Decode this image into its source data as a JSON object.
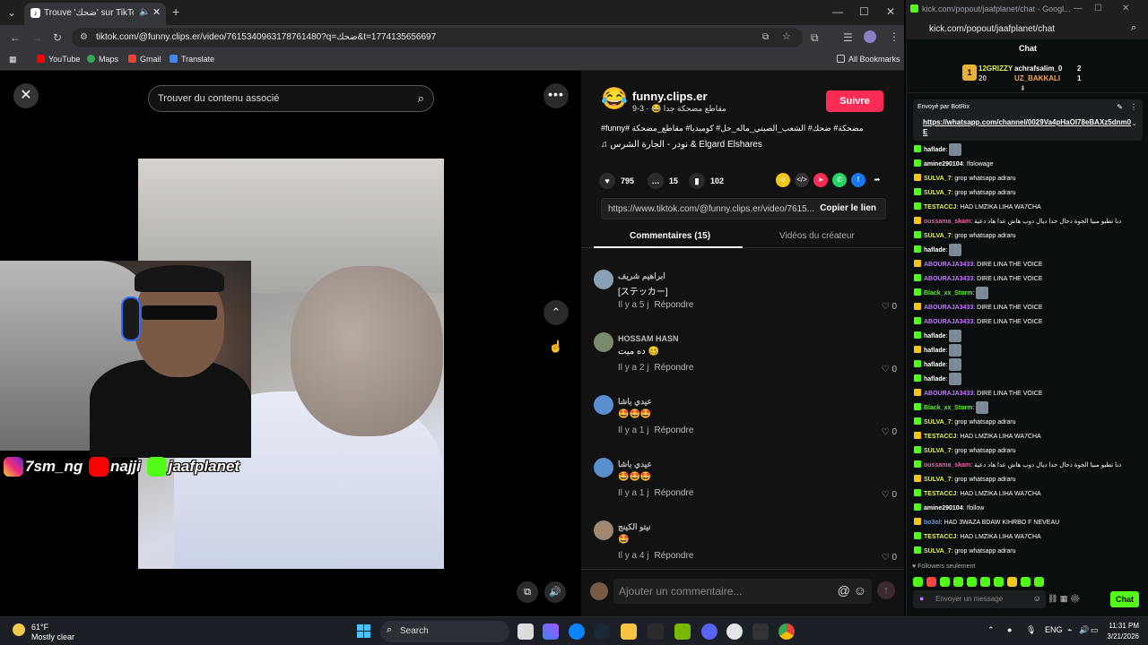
{
  "browser": {
    "tab_title": "Trouve 'ضحك' sur TikTok | T",
    "url": "tiktok.com/@funny.clips.er/video/7615340963178761480?q=ضحك&t=1774135656697",
    "bookmarks": [
      "YouTube",
      "Maps",
      "Gmail",
      "Translate"
    ],
    "all_bookmarks": "All Bookmarks"
  },
  "tiktok": {
    "search_placeholder": "Trouver du contenu associé",
    "author_name": "funny.clips.er",
    "author_sub": "مقاطع مضحكة جدا 😂 · 3-9",
    "follow_label": "Suivre",
    "caption": "#funny# مضحكة# ضحك# الشعب_الصيني_ماله_حل# كوميديا# مقاطع_مضحكة",
    "music": "♫ نودر - الجارة الشرس & Elgard Elshares",
    "likes": "795",
    "comments_count": "15",
    "saves": "102",
    "link": "https://www.tiktok.com/@funny.clips.er/video/7615...",
    "copy_label": "Copier le lien",
    "tab_comments": "Commentaires (15)",
    "tab_videos": "Vidéos du créateur",
    "comments": [
      {
        "name": "ابراهيم شريف",
        "text": "[ステッカー]",
        "time": "Il y a 5 j",
        "reply": "Répondre",
        "likes": "0"
      },
      {
        "name": "HOSSAM HASN",
        "text": "ده ميت 🥴",
        "time": "Il y a 2 j",
        "reply": "Répondre",
        "likes": "0"
      },
      {
        "name": "عيدي باشا",
        "text": "🤩🤩🤩",
        "time": "Il y a 1 j",
        "reply": "Répondre",
        "likes": "0"
      },
      {
        "name": "عيدي باشا",
        "text": "🤩🤩🤩",
        "time": "Il y a 1 j",
        "reply": "Répondre",
        "likes": "0"
      },
      {
        "name": "نيتو الكينج",
        "text": "🤩",
        "time": "Il y a 4 j",
        "reply": "Répondre",
        "likes": "0"
      }
    ],
    "add_comment_placeholder": "Ajouter un commentaire..."
  },
  "overlay": {
    "socials": [
      "7sm_ng",
      "najji",
      "jaafplanet"
    ]
  },
  "chat": {
    "window_title": "kick.com/popout/jaafplanet/chat - Googl...",
    "url": "kick.com/popout/jaafplanet/chat",
    "header": "Chat",
    "top_gifters": [
      {
        "name": "12GRIZZY",
        "count": "20"
      },
      {
        "name": "achrafsalim_0",
        "count": "2"
      },
      {
        "name": "UZ_BAKKALI",
        "count": "1"
      }
    ],
    "pinned_label": "Envoyé par BotRix",
    "pinned_link": "https://whatsapp.com/channel/0029Va4pHaOI78eBAXz5dnm0E",
    "messages": [
      {
        "nick": "haflade",
        "text": "",
        "color": "#ffffff"
      },
      {
        "nick": "amine290104",
        "text": "!folowage",
        "color": "#ffffff"
      },
      {
        "nick": "SULVA_7",
        "text": "grop whatsapp adraru",
        "color": "#e6f05a"
      },
      {
        "nick": "SULVA_7",
        "text": "grop whatsapp adraru",
        "color": "#e6f05a"
      },
      {
        "nick": "TESTACCJ",
        "text": "HAD LMZIKA LIHA WA7CHA",
        "color": "#e6f05a"
      },
      {
        "nick": "oussama_skam",
        "text": "دبا تطبو مبيا الجوة دحال حدا ديال دوب هاش عدا هاد دعية",
        "color": "#ff5ca8"
      },
      {
        "nick": "SULVA_7",
        "text": "grop whatsapp adraru",
        "color": "#e6f05a"
      },
      {
        "nick": "haflade",
        "text": "",
        "color": "#ffffff"
      },
      {
        "nick": "ABOURAJA3433",
        "text": "DIRE LINA THE VOICE",
        "color": "#c27bff"
      },
      {
        "nick": "ABOURAJA3433",
        "text": "DIRE LINA THE VOICE",
        "color": "#c27bff"
      },
      {
        "nick": "Black_xx_Storm",
        "text": "",
        "color": "#53fc18"
      },
      {
        "nick": "ABOURAJA3433",
        "text": "DIRE LINA THE VOICE",
        "color": "#c27bff"
      },
      {
        "nick": "ABOURAJA3433",
        "text": "DIRE LINA THE VOICE",
        "color": "#c27bff"
      },
      {
        "nick": "haflade",
        "text": "",
        "color": "#ffffff"
      },
      {
        "nick": "haflade",
        "text": "",
        "color": "#ffffff"
      },
      {
        "nick": "haflade",
        "text": "",
        "color": "#ffffff"
      },
      {
        "nick": "haflade",
        "text": "",
        "color": "#ffffff"
      },
      {
        "nick": "ABOURAJA3433",
        "text": "DIRE LINA THE VOICE",
        "color": "#c27bff"
      },
      {
        "nick": "Black_xx_Storm",
        "text": "",
        "color": "#53fc18"
      },
      {
        "nick": "SULVA_7",
        "text": "grop whatsapp adraru",
        "color": "#e6f05a"
      },
      {
        "nick": "TESTACCJ",
        "text": "HAD LMZIKA LIHA WA7CHA",
        "color": "#e6f05a"
      },
      {
        "nick": "SULVA_7",
        "text": "grop whatsapp adraru",
        "color": "#e6f05a"
      },
      {
        "nick": "oussama_skam",
        "text": "دبا تطبو مبيا الجوة دحال حدا ديال دوب هاش عدا هاد دعية",
        "color": "#ff5ca8"
      },
      {
        "nick": "SULVA_7",
        "text": "grop whatsapp adraru",
        "color": "#e6f05a"
      },
      {
        "nick": "TESTACCJ",
        "text": "HAD LMZIKA LIHA WA7CHA",
        "color": "#e6f05a"
      },
      {
        "nick": "amine290104",
        "text": "!follow",
        "color": "#ffffff"
      },
      {
        "nick": "bo3ol",
        "text": "HAD 3WAZA BDAW KIHRBO F NEVEAU",
        "color": "#4aa3ff"
      },
      {
        "nick": "TESTACCJ",
        "text": "HAD LMZIKA LIHA WA7CHA",
        "color": "#e6f05a"
      },
      {
        "nick": "SULVA_7",
        "text": "grop whatsapp adraru",
        "color": "#e6f05a"
      }
    ],
    "followers_only": "Followers seulement",
    "input_placeholder": "Envoyer un message",
    "send_label": "Chat"
  },
  "taskbar": {
    "temp": "61°F",
    "weather": "Mostly clear",
    "search": "Search",
    "lang": "ENG",
    "time": "11:31 PM",
    "date": "3/21/2026"
  }
}
